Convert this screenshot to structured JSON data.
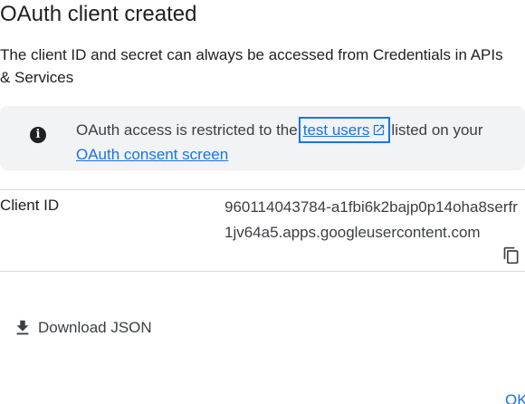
{
  "dialog": {
    "title": "OAuth client created",
    "description": "The client ID and secret can always be accessed from Credentials in APIs & Services"
  },
  "banner": {
    "icon": "info-icon",
    "text_before": "OAuth access is restricted to the",
    "link_test_users": "test users",
    "text_middle": "listed on your",
    "link_consent": "OAuth consent screen"
  },
  "client": {
    "label": "Client ID",
    "value": "960114043784-a1fbi6k2bajp0p14oha8serfr1jv64a5.apps.googleusercontent.com",
    "copy_icon": "copy-icon"
  },
  "actions": {
    "download_label": "Download JSON",
    "download_icon": "download-icon",
    "ok_label": "OK"
  },
  "colors": {
    "accent": "#1a73e8",
    "banner_bg": "#f1f3f4",
    "divider": "#dadce0",
    "text": "#202124"
  }
}
